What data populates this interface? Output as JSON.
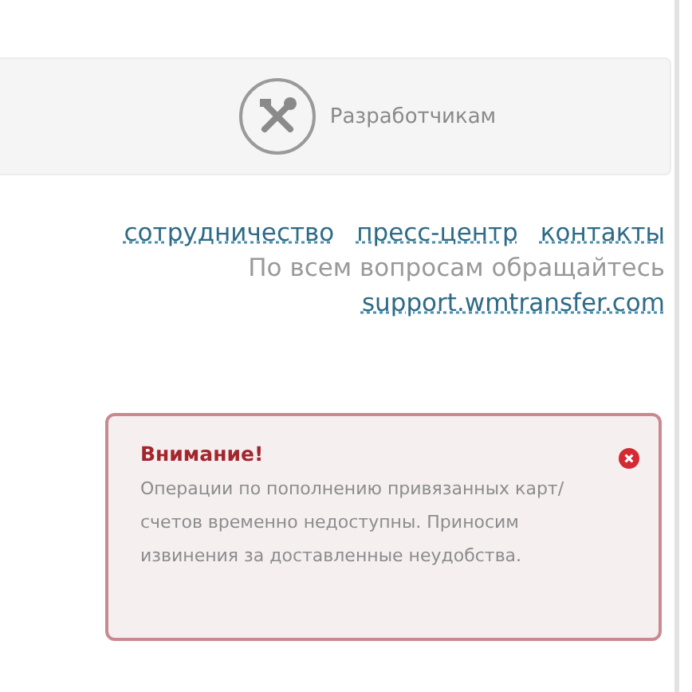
{
  "developer_panel": {
    "label": "Разработчикам"
  },
  "footer": {
    "links": [
      "сотрудничество",
      "пресс-центр",
      "контакты"
    ],
    "support_text": "По всем вопросам обращайтесь",
    "support_link": "support.wmtransfer.com"
  },
  "alert": {
    "title": "Внимание!",
    "message": "Операции по пополнению привязанных карт/счетов временно недоступны. Приносим извинения за доставленные неудобства.",
    "closable": true
  }
}
